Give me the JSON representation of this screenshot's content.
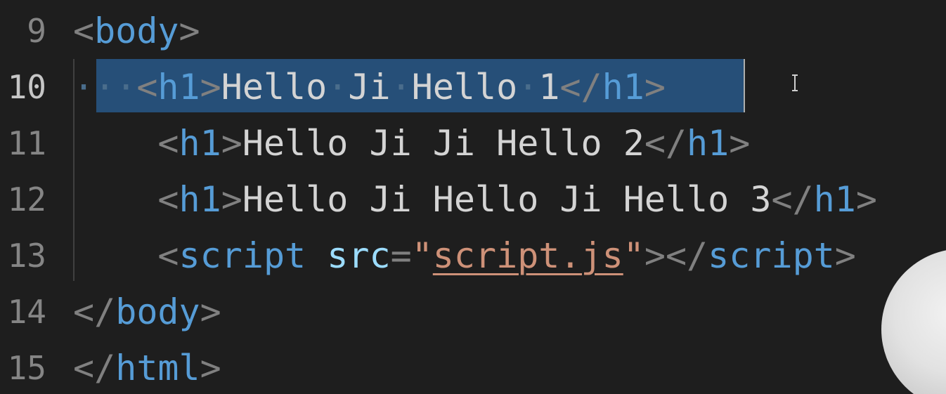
{
  "editor": {
    "lines": [
      {
        "number": "9",
        "tokens": [
          [
            "p",
            "<"
          ],
          [
            "t",
            "body"
          ],
          [
            "p",
            ">"
          ]
        ]
      },
      {
        "number": "10",
        "tokens": [
          [
            "ws",
            "···"
          ],
          [
            "p",
            "<"
          ],
          [
            "t",
            "h1"
          ],
          [
            "p",
            ">"
          ],
          [
            "tx",
            "Hello"
          ],
          [
            "ws",
            "·"
          ],
          [
            "tx",
            "Ji"
          ],
          [
            "ws",
            "·"
          ],
          [
            "tx",
            "Hello"
          ],
          [
            "ws",
            "·"
          ],
          [
            "tx",
            "1"
          ],
          [
            "p",
            "</"
          ],
          [
            "t",
            "h1"
          ],
          [
            "p",
            ">"
          ]
        ]
      },
      {
        "number": "11",
        "tokens": [
          [
            "tx",
            "    "
          ],
          [
            "p",
            "<"
          ],
          [
            "t",
            "h1"
          ],
          [
            "p",
            ">"
          ],
          [
            "tx",
            "Hello Ji Ji Hello 2"
          ],
          [
            "p",
            "</"
          ],
          [
            "t",
            "h1"
          ],
          [
            "p",
            ">"
          ]
        ]
      },
      {
        "number": "12",
        "tokens": [
          [
            "tx",
            "    "
          ],
          [
            "p",
            "<"
          ],
          [
            "t",
            "h1"
          ],
          [
            "p",
            ">"
          ],
          [
            "tx",
            "Hello Ji Hello Ji Hello 3"
          ],
          [
            "p",
            "</"
          ],
          [
            "t",
            "h1"
          ],
          [
            "p",
            ">"
          ]
        ]
      },
      {
        "number": "13",
        "tokens": [
          [
            "tx",
            "    "
          ],
          [
            "p",
            "<"
          ],
          [
            "t",
            "script"
          ],
          [
            "tx",
            " "
          ],
          [
            "a",
            "src"
          ],
          [
            "p",
            "="
          ],
          [
            "s",
            "\""
          ],
          [
            "s-link",
            "script.js"
          ],
          [
            "s",
            "\""
          ],
          [
            "p",
            "></"
          ],
          [
            "t",
            "script"
          ],
          [
            "p",
            ">"
          ]
        ]
      },
      {
        "number": "14",
        "tokens": [
          [
            "p",
            "</"
          ],
          [
            "t",
            "body"
          ],
          [
            "p",
            ">"
          ]
        ]
      },
      {
        "number": "15",
        "tokens": [
          [
            "p",
            "</"
          ],
          [
            "t",
            "html"
          ],
          [
            "p",
            ">"
          ]
        ]
      }
    ],
    "active_line": "10",
    "colors": {
      "background": "#1e1e1e",
      "tag": "#569cd6",
      "attribute": "#9cdcfe",
      "string": "#ce9178",
      "text": "#d4d4d4",
      "punctuation": "#808080",
      "selection": "#264f78"
    }
  }
}
